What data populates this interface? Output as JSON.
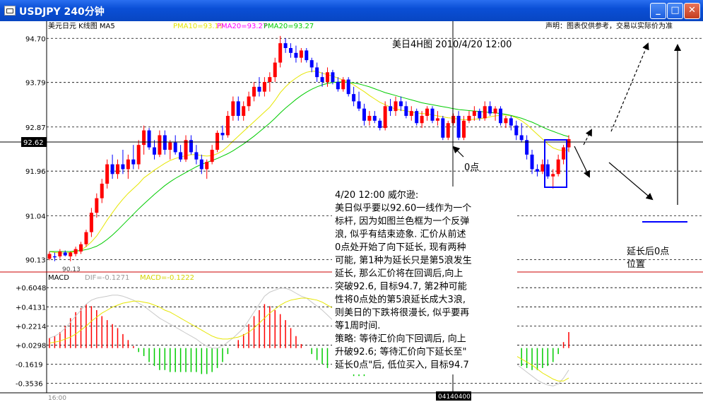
{
  "window": {
    "title": "USDJPY 240分钟",
    "minimize_glyph": "_",
    "maximize_glyph": "□",
    "close_glyph": "✕"
  },
  "chart_data": [
    {
      "type": "candlestick",
      "indicator_label": "美元日元  K线图  MA5",
      "ma_labels": [
        "PMA10=93.19",
        "PMA20=93.27",
        "PMA20=93.27"
      ],
      "ma_colors": [
        "#e6e600",
        "#ff00ff",
        "#00cc00"
      ],
      "disclaimer": "声明：图表仅供参考，交易以实际价为准",
      "chart_title": "美日4H图 2010/4/20 12:00",
      "ylim": [
        89.95,
        94.85
      ],
      "y_ticks": [
        "94.70",
        "93.79",
        "92.87",
        "91.96",
        "91.04",
        "90.13"
      ],
      "y_tick_values": [
        94.7,
        93.79,
        92.87,
        91.96,
        91.04,
        90.13
      ],
      "current_price_label": "92.62",
      "current_price": 92.62,
      "low_label": "90.13",
      "bar_count": 124,
      "candles": [
        [
          90.15,
          90.3,
          90.12,
          90.25
        ],
        [
          90.2,
          90.28,
          90.1,
          90.18
        ],
        [
          90.2,
          90.35,
          90.15,
          90.3
        ],
        [
          90.28,
          90.32,
          90.2,
          90.22
        ],
        [
          90.2,
          90.3,
          90.1,
          90.28
        ],
        [
          90.25,
          90.4,
          90.2,
          90.35
        ],
        [
          90.3,
          90.5,
          90.25,
          90.45
        ],
        [
          90.45,
          90.75,
          90.4,
          90.7
        ],
        [
          90.7,
          91.2,
          90.6,
          91.1
        ],
        [
          91.1,
          91.5,
          91.0,
          91.4
        ],
        [
          91.4,
          91.8,
          91.3,
          91.7
        ],
        [
          91.7,
          92.2,
          91.6,
          92.1
        ],
        [
          92.1,
          92.3,
          91.8,
          91.9
        ],
        [
          91.9,
          92.2,
          91.8,
          92.1
        ],
        [
          92.1,
          92.4,
          91.9,
          92.0
        ],
        [
          92.0,
          92.3,
          91.8,
          92.2
        ],
        [
          92.2,
          92.5,
          92.0,
          92.1
        ],
        [
          92.1,
          92.6,
          92.0,
          92.5
        ],
        [
          92.5,
          92.9,
          92.3,
          92.8
        ],
        [
          92.8,
          92.85,
          92.4,
          92.45
        ],
        [
          92.45,
          92.6,
          92.2,
          92.3
        ],
        [
          92.3,
          92.8,
          92.25,
          92.7
        ],
        [
          92.7,
          92.8,
          92.3,
          92.4
        ],
        [
          92.4,
          92.6,
          92.2,
          92.55
        ],
        [
          92.55,
          92.7,
          92.3,
          92.35
        ],
        [
          92.35,
          92.5,
          92.15,
          92.2
        ],
        [
          92.2,
          92.7,
          92.15,
          92.6
        ],
        [
          92.6,
          92.7,
          92.3,
          92.35
        ],
        [
          92.35,
          92.5,
          92.1,
          92.2
        ],
        [
          92.2,
          92.3,
          91.9,
          92.0
        ],
        [
          92.0,
          92.2,
          91.8,
          92.15
        ],
        [
          92.15,
          92.5,
          92.1,
          92.4
        ],
        [
          92.4,
          92.8,
          92.35,
          92.75
        ],
        [
          92.75,
          92.9,
          92.6,
          92.7
        ],
        [
          92.7,
          93.2,
          92.65,
          93.1
        ],
        [
          93.1,
          93.5,
          93.0,
          93.4
        ],
        [
          93.4,
          93.5,
          93.0,
          93.1
        ],
        [
          93.1,
          93.4,
          93.0,
          93.3
        ],
        [
          93.3,
          93.6,
          93.2,
          93.5
        ],
        [
          93.5,
          93.8,
          93.4,
          93.7
        ],
        [
          93.7,
          93.9,
          93.5,
          93.6
        ],
        [
          93.6,
          93.9,
          93.5,
          93.8
        ],
        [
          93.8,
          94.0,
          93.6,
          93.9
        ],
        [
          93.9,
          94.3,
          93.8,
          94.2
        ],
        [
          94.2,
          94.75,
          94.1,
          94.6
        ],
        [
          94.6,
          94.7,
          94.4,
          94.5
        ],
        [
          94.5,
          94.6,
          94.3,
          94.4
        ],
        [
          94.4,
          94.55,
          94.2,
          94.3
        ],
        [
          94.3,
          94.5,
          94.2,
          94.45
        ],
        [
          94.45,
          94.5,
          94.2,
          94.25
        ],
        [
          94.25,
          94.3,
          94.0,
          94.1
        ],
        [
          94.1,
          94.2,
          93.8,
          93.9
        ],
        [
          93.9,
          94.0,
          93.7,
          93.8
        ],
        [
          93.8,
          94.1,
          93.7,
          94.0
        ],
        [
          94.0,
          94.05,
          93.75,
          93.8
        ],
        [
          93.8,
          93.9,
          93.6,
          93.65
        ],
        [
          93.65,
          93.9,
          93.6,
          93.85
        ],
        [
          93.85,
          93.9,
          93.5,
          93.55
        ],
        [
          93.55,
          93.7,
          93.3,
          93.4
        ],
        [
          93.4,
          93.6,
          93.2,
          93.25
        ],
        [
          93.25,
          93.35,
          92.9,
          93.0
        ],
        [
          93.0,
          93.2,
          92.9,
          93.1
        ],
        [
          93.1,
          93.2,
          92.95,
          93.0
        ],
        [
          93.0,
          93.05,
          92.8,
          92.85
        ],
        [
          92.85,
          93.4,
          92.8,
          93.3
        ],
        [
          93.3,
          93.45,
          93.1,
          93.2
        ],
        [
          93.2,
          93.5,
          93.1,
          93.4
        ],
        [
          93.4,
          93.5,
          93.2,
          93.3
        ],
        [
          93.3,
          93.4,
          93.05,
          93.1
        ],
        [
          93.1,
          93.3,
          93.0,
          93.2
        ],
        [
          93.2,
          93.25,
          92.9,
          92.95
        ],
        [
          92.95,
          93.2,
          92.85,
          93.1
        ],
        [
          93.1,
          93.3,
          93.0,
          93.25
        ],
        [
          93.25,
          93.3,
          92.95,
          93.0
        ],
        [
          93.0,
          93.2,
          92.9,
          93.05
        ],
        [
          93.05,
          93.1,
          92.6,
          92.65
        ],
        [
          92.65,
          93.0,
          92.6,
          92.95
        ],
        [
          92.95,
          93.15,
          92.9,
          93.1
        ],
        [
          93.1,
          93.2,
          92.6,
          92.65
        ],
        [
          92.65,
          93.1,
          92.6,
          93.0
        ],
        [
          93.0,
          93.2,
          92.95,
          93.1
        ],
        [
          93.1,
          93.3,
          93.0,
          93.2
        ],
        [
          93.2,
          93.25,
          93.0,
          93.05
        ],
        [
          93.05,
          93.4,
          93.0,
          93.3
        ],
        [
          93.3,
          93.4,
          93.1,
          93.15
        ],
        [
          93.15,
          93.3,
          93.0,
          93.25
        ],
        [
          93.25,
          93.3,
          92.9,
          92.95
        ],
        [
          92.95,
          93.1,
          92.85,
          93.05
        ],
        [
          93.05,
          93.1,
          92.8,
          92.9
        ],
        [
          92.9,
          93.0,
          92.6,
          92.7
        ],
        [
          92.7,
          92.95,
          92.55,
          92.6
        ],
        [
          92.6,
          92.7,
          92.2,
          92.3
        ],
        [
          92.3,
          92.4,
          91.9,
          92.0
        ],
        [
          92.0,
          92.1,
          91.85,
          91.95
        ],
        [
          91.95,
          92.2,
          91.9,
          92.1
        ],
        [
          92.1,
          92.2,
          91.8,
          91.85
        ],
        [
          91.85,
          92.0,
          91.6,
          91.9
        ],
        [
          91.9,
          92.3,
          91.85,
          92.2
        ],
        [
          92.2,
          92.5,
          92.1,
          92.45
        ],
        [
          92.45,
          92.7,
          92.35,
          92.62
        ]
      ],
      "ma10": [
        90.3,
        90.28,
        90.27,
        90.27,
        90.28,
        90.3,
        90.33,
        90.4,
        90.5,
        90.62,
        90.78,
        90.95,
        91.1,
        91.25,
        91.38,
        91.5,
        91.6,
        91.7,
        91.82,
        91.9,
        91.98,
        92.05,
        92.12,
        92.18,
        92.22,
        92.25,
        92.28,
        92.3,
        92.3,
        92.28,
        92.27,
        92.28,
        92.32,
        92.38,
        92.47,
        92.58,
        92.68,
        92.78,
        92.88,
        92.98,
        93.08,
        93.18,
        93.28,
        93.42,
        93.58,
        93.7,
        93.8,
        93.88,
        93.95,
        94.0,
        94.02,
        94.02,
        93.98,
        93.95,
        93.92,
        93.88,
        93.84,
        93.8,
        93.74,
        93.67,
        93.6,
        93.52,
        93.45,
        93.38,
        93.33,
        93.28,
        93.24,
        93.22,
        93.2,
        93.18,
        93.16,
        93.15,
        93.14,
        93.12,
        93.1,
        93.08,
        93.06,
        93.05,
        93.03,
        93.02,
        93.02,
        93.03,
        93.04,
        93.06,
        93.08,
        93.1,
        93.11,
        93.12,
        93.1,
        93.06,
        93.0,
        92.92,
        92.82,
        92.72,
        92.62,
        92.52,
        92.44,
        92.4,
        92.38,
        92.4
      ],
      "ma20": [
        90.3,
        90.3,
        90.3,
        90.3,
        90.3,
        90.31,
        90.32,
        90.34,
        90.37,
        90.41,
        90.47,
        90.55,
        90.64,
        90.74,
        90.85,
        90.96,
        91.07,
        91.18,
        91.28,
        91.38,
        91.48,
        91.57,
        91.66,
        91.74,
        91.81,
        91.87,
        91.93,
        91.99,
        92.05,
        92.1,
        92.14,
        92.18,
        92.22,
        92.27,
        92.32,
        92.38,
        92.45,
        92.52,
        92.6,
        92.68,
        92.77,
        92.86,
        92.95,
        93.05,
        93.16,
        93.26,
        93.35,
        93.44,
        93.52,
        93.59,
        93.65,
        93.7,
        93.74,
        93.77,
        93.79,
        93.8,
        93.8,
        93.79,
        93.78,
        93.76,
        93.73,
        93.7,
        93.66,
        93.62,
        93.58,
        93.55,
        93.52,
        93.49,
        93.46,
        93.43,
        93.4,
        93.37,
        93.35,
        93.33,
        93.31,
        93.29,
        93.27,
        93.25,
        93.23,
        93.22,
        93.21,
        93.2,
        93.19,
        93.18,
        93.17,
        93.16,
        93.15,
        93.13,
        93.11,
        93.08,
        93.05,
        93.01,
        92.97,
        92.92,
        92.87,
        92.82,
        92.78,
        92.74,
        92.7,
        92.67
      ],
      "zero_point_label": "0点",
      "annotation_lines": [
        "4/20 12:00 威尔逊:",
        "美日似乎要以92.60一线作为一个",
        "标杆, 因为如图兰色框为一个反弹",
        "浪, 似乎有结束迹象. 汇价从前述",
        "0点处开始了向下延长, 现有两种",
        "可能, 第1种为延长只是第5浪发生",
        "延长, 那么汇价将在回调后,向上",
        "突破92.6, 目标94.7, 第2种可能",
        "性将0点处的第5浪延长成大3浪,",
        "则美日的下跌将很漫长, 似乎要再",
        "等1周时间.",
        "策略: 等待汇价向下回调后, 向上",
        "升破92.6; 等待汇价向下延长至\"",
        "延长0点\"后, 低位买入, 目标94.7"
      ],
      "extension_label": "延长后0点\n位置"
    },
    {
      "type": "macd",
      "title": "MACD",
      "dif_label": "DIF=-0.1271",
      "macd_label": "MACD=-0.1222",
      "ylim": [
        -0.42,
        0.67
      ],
      "y_ticks": [
        "+0.6048",
        "+0.4131",
        "+0.2214",
        "+0.0298",
        "-0.1619",
        "-0.3536"
      ],
      "y_tick_values": [
        0.6048,
        0.4131,
        0.2214,
        0.0298,
        -0.1619,
        -0.3536
      ],
      "dif": [
        0.1,
        0.12,
        0.15,
        0.2,
        0.26,
        0.32,
        0.38,
        0.44,
        0.48,
        0.5,
        0.51,
        0.52,
        0.53,
        0.53,
        0.52,
        0.5,
        0.48,
        0.45,
        0.42,
        0.38,
        0.34,
        0.3,
        0.27,
        0.24,
        0.21,
        0.18,
        0.15,
        0.12,
        0.09,
        0.05,
        0.02,
        0.0,
        0.0,
        0.02,
        0.06,
        0.1,
        0.15,
        0.2,
        0.28,
        0.36,
        0.44,
        0.52,
        0.56,
        0.58,
        0.6,
        0.6,
        0.58,
        0.55,
        0.52,
        0.5,
        0.46,
        0.42,
        0.38,
        0.33,
        0.28,
        0.24,
        0.2,
        0.16,
        0.12,
        0.08,
        0.04,
        0.02,
        0.0,
        -0.02,
        -0.04,
        -0.04,
        -0.05,
        -0.05,
        -0.06,
        -0.06,
        -0.06,
        -0.05,
        -0.05,
        -0.05,
        -0.04,
        -0.04,
        -0.05,
        -0.05,
        -0.04,
        -0.04,
        -0.03,
        -0.03,
        -0.02,
        -0.02,
        -0.03,
        -0.04,
        -0.06,
        -0.09,
        -0.12,
        -0.16,
        -0.2,
        -0.24,
        -0.28,
        -0.32,
        -0.35,
        -0.37,
        -0.38,
        -0.36,
        -0.3,
        -0.22
      ],
      "dea": [
        0.05,
        0.06,
        0.07,
        0.09,
        0.11,
        0.14,
        0.18,
        0.22,
        0.27,
        0.31,
        0.35,
        0.38,
        0.41,
        0.43,
        0.45,
        0.46,
        0.47,
        0.47,
        0.46,
        0.45,
        0.43,
        0.41,
        0.38,
        0.36,
        0.33,
        0.3,
        0.27,
        0.24,
        0.21,
        0.18,
        0.15,
        0.12,
        0.1,
        0.09,
        0.09,
        0.1,
        0.11,
        0.13,
        0.16,
        0.2,
        0.25,
        0.3,
        0.35,
        0.39,
        0.43,
        0.46,
        0.48,
        0.49,
        0.5,
        0.5,
        0.49,
        0.48,
        0.46,
        0.43,
        0.4,
        0.37,
        0.33,
        0.29,
        0.26,
        0.22,
        0.18,
        0.15,
        0.12,
        0.09,
        0.06,
        0.04,
        0.02,
        0.0,
        -0.01,
        -0.02,
        -0.03,
        -0.03,
        -0.04,
        -0.04,
        -0.04,
        -0.04,
        -0.04,
        -0.04,
        -0.04,
        -0.04,
        -0.04,
        -0.04,
        -0.03,
        -0.03,
        -0.03,
        -0.03,
        -0.04,
        -0.05,
        -0.06,
        -0.08,
        -0.11,
        -0.14,
        -0.17,
        -0.21,
        -0.25,
        -0.28,
        -0.31,
        -0.33,
        -0.33,
        -0.3
      ]
    }
  ],
  "xaxis": {
    "first_label": "16:00",
    "cursor_label": "04140400"
  },
  "colors": {
    "up": "#ff0000",
    "down": "#0000ff",
    "box": "#0000ff",
    "hist_pos": "#ff0000",
    "hist_neg": "#00cc00",
    "dif": "#c8c8c8",
    "dea": "#e6e600",
    "separator": "#cc0000"
  }
}
